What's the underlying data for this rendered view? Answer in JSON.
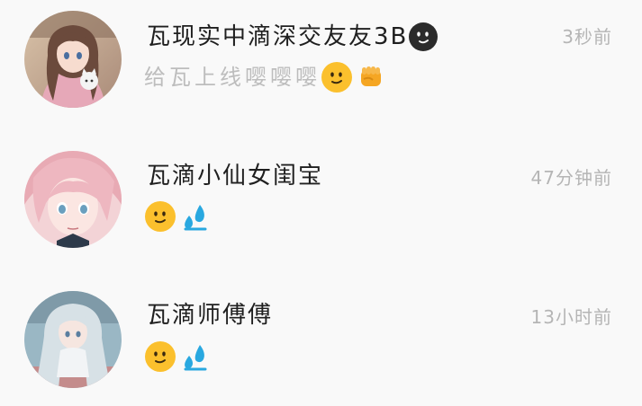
{
  "chats": [
    {
      "name": "瓦现实中滴深交友友3B",
      "name_emoji": "dark-smiling-face",
      "time": "3秒前",
      "message": "给瓦上线嘤嘤嘤",
      "message_emojis": [
        "slightly-smiling-face",
        "fist"
      ]
    },
    {
      "name": "瓦滴小仙女闺宝",
      "time": "47分钟前",
      "message": "",
      "message_emojis": [
        "slightly-smiling-face",
        "sweat-droplets"
      ]
    },
    {
      "name": "瓦滴师傅傅",
      "time": "13小时前",
      "message": "",
      "message_emojis": [
        "slightly-smiling-face",
        "sweat-droplets"
      ]
    }
  ],
  "colors": {
    "background": "#f9f9f9",
    "name_text": "#1f1f1f",
    "time_text": "#b5b5b5",
    "message_text": "#bdbdbd",
    "emoji_yellow": "#fbc02d",
    "droplet_blue": "#29a8e0"
  }
}
